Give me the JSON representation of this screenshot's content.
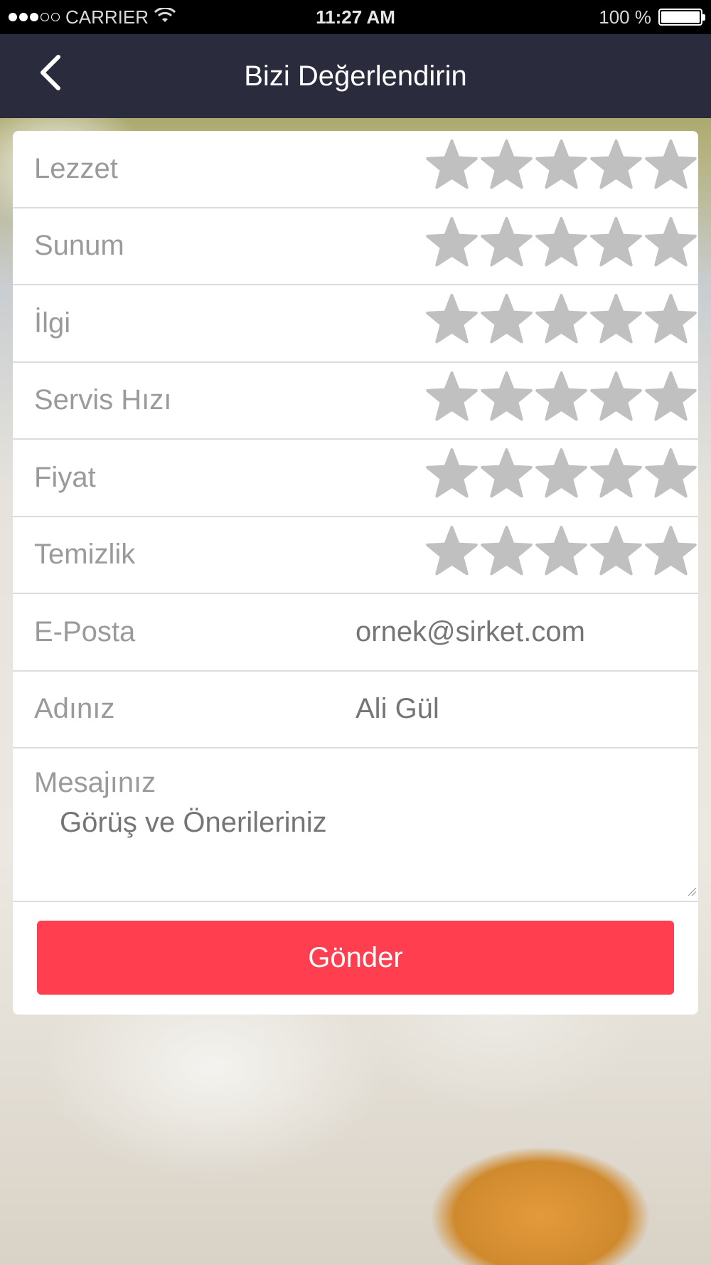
{
  "status_bar": {
    "carrier": "CARRIER",
    "time": "11:27 AM",
    "battery": "100 %",
    "signal_bars_filled": 3,
    "signal_bars_total": 5
  },
  "nav": {
    "title": "Bizi Değerlendirin"
  },
  "ratings": [
    {
      "label": "Lezzet",
      "stars": 0,
      "max": 5
    },
    {
      "label": "Sunum",
      "stars": 0,
      "max": 5
    },
    {
      "label": "İlgi",
      "stars": 0,
      "max": 5
    },
    {
      "label": "Servis Hızı",
      "stars": 0,
      "max": 5
    },
    {
      "label": "Fiyat",
      "stars": 0,
      "max": 5
    },
    {
      "label": "Temizlik",
      "stars": 0,
      "max": 5
    }
  ],
  "form": {
    "email_label": "E-Posta",
    "email_placeholder": "ornek@sirket.com",
    "name_label": "Adınız",
    "name_placeholder": "Ali Gül",
    "message_label": "Mesajınız",
    "message_placeholder": "Görüş ve Önerileriniz",
    "submit_label": "Gönder"
  },
  "colors": {
    "navbar": "#2a2c3d",
    "submit": "#ff3f4f",
    "star_empty": "#c0c0c0",
    "label": "#9a9a9a"
  }
}
